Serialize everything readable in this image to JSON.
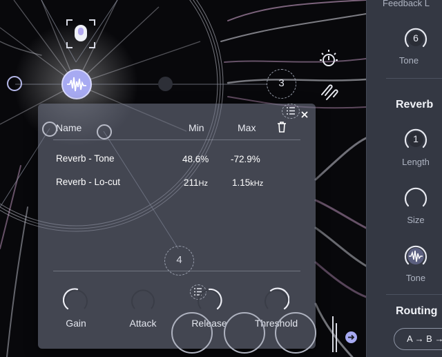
{
  "right_panel": {
    "feedback_label": "Feedback L",
    "tone_top_value": "6",
    "tone_top_label": "Tone",
    "reverb_heading": "Reverb",
    "length_value": "1",
    "length_label": "Length",
    "size_label": "Size",
    "tone_bottom_label": "Tone",
    "routing_heading": "Routing",
    "routing_button": "A → B →"
  },
  "canvas": {
    "node_3": "3",
    "node_4": "4"
  },
  "popup": {
    "headers": {
      "name": "Name",
      "min": "Min",
      "max": "Max"
    },
    "rows": [
      {
        "name": "Reverb - Tone",
        "min": "48.6%",
        "max": "-72.9%",
        "min_unit": "",
        "max_unit": ""
      },
      {
        "name": "Reverb - Lo-cut",
        "min": "211",
        "min_unit": "Hz",
        "max": "1.15",
        "max_unit": "kHz"
      }
    ],
    "knobs": [
      "Gain",
      "Attack",
      "Release",
      "Threshold"
    ]
  },
  "colors": {
    "accent": "#a7aaf2",
    "panel": "#343843",
    "popup": "#6e7484"
  }
}
